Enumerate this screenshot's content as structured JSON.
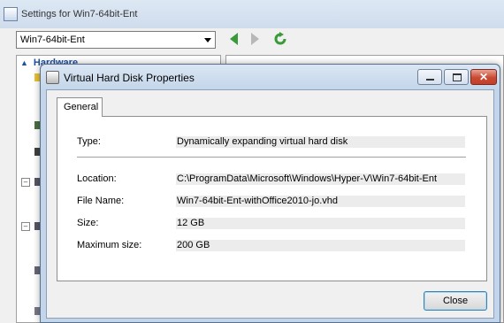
{
  "window": {
    "title": "Settings for Win7-64bit-Ent",
    "vm_selector": {
      "value": "Win7-64bit-Ent"
    },
    "hardware_header": "Hardware"
  },
  "dialog": {
    "title": "Virtual Hard Disk Properties",
    "tabs": [
      "General"
    ],
    "type": {
      "label": "Type:",
      "value": "Dynamically expanding virtual hard disk"
    },
    "location": {
      "label": "Location:",
      "value": "C:\\ProgramData\\Microsoft\\Windows\\Hyper-V\\Win7-64bit-Ent"
    },
    "file_name": {
      "label": "File Name:",
      "value": "Win7-64bit-Ent-withOffice2010-jo.vhd"
    },
    "size": {
      "label": "Size:",
      "value": "12 GB"
    },
    "max_size": {
      "label": "Maximum size:",
      "value": "200 GB"
    },
    "close_label": "Close"
  },
  "colors": {
    "accent": "#1e4e9e",
    "nav_green": "#3a9a3a",
    "close_red": "#c84a33"
  },
  "icons": [
    "settings-app-icon",
    "back-arrow-icon",
    "forward-arrow-icon",
    "refresh-icon",
    "chevron-up-icon",
    "vhd-icon",
    "minimize-icon",
    "maximize-icon",
    "close-icon"
  ]
}
